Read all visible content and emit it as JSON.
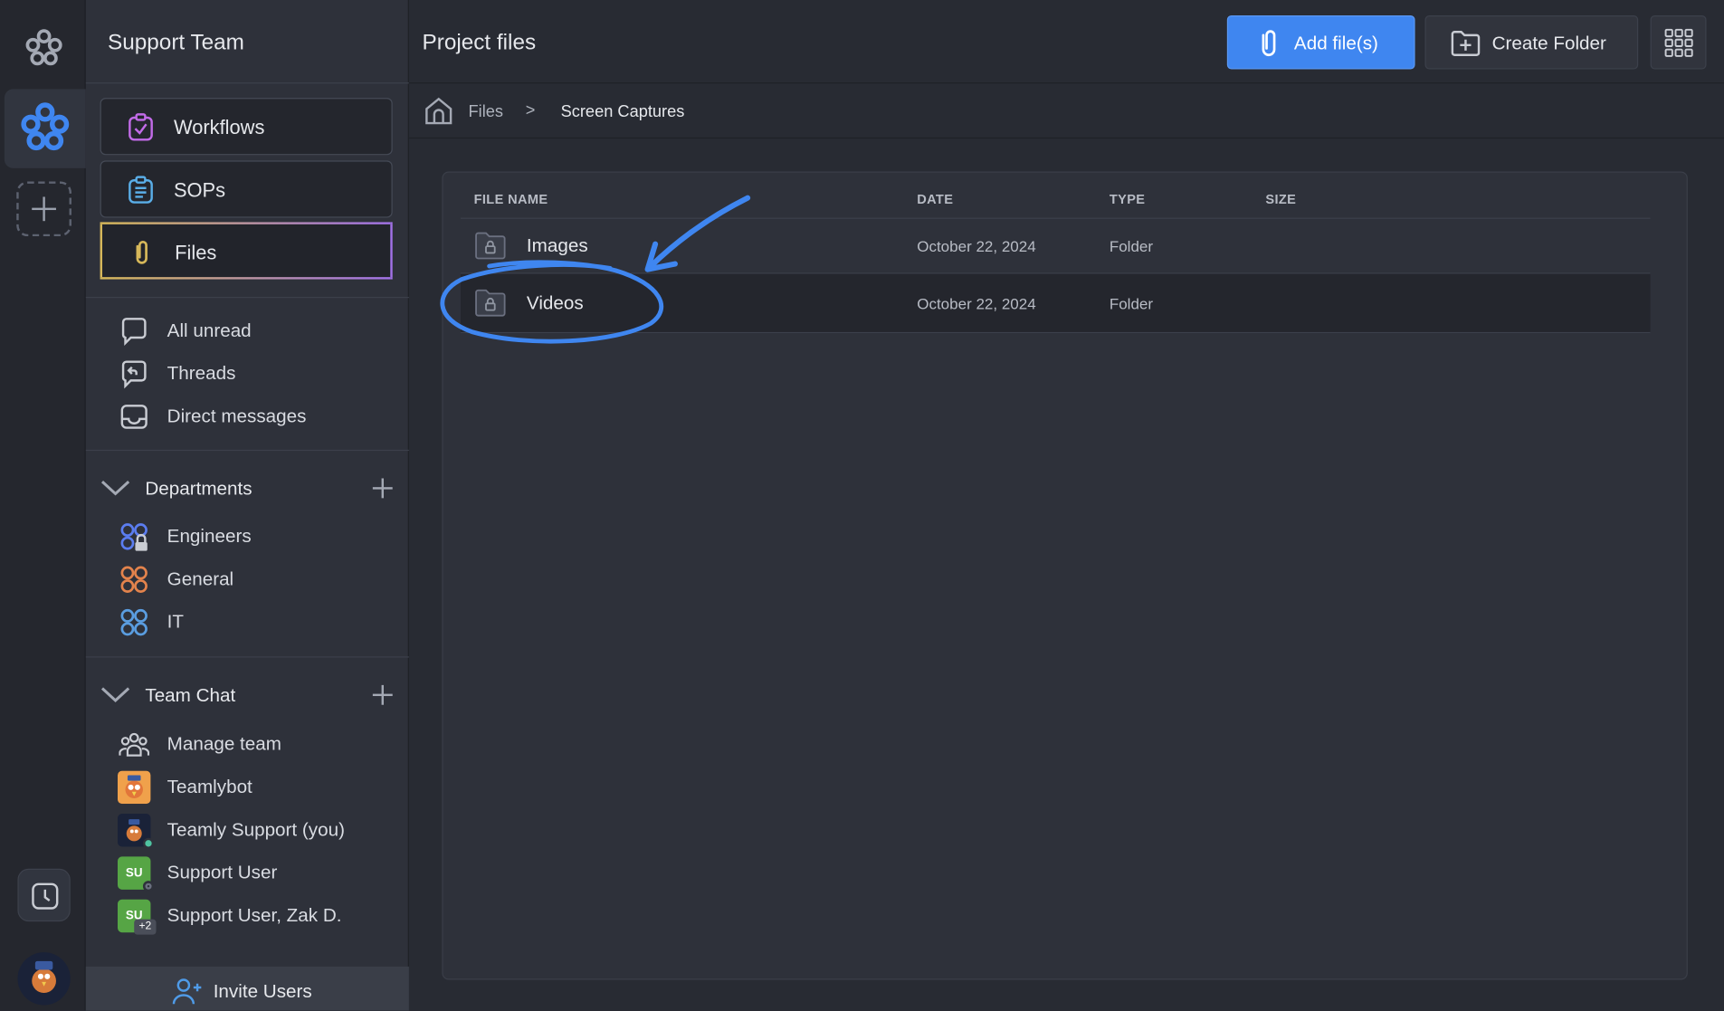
{
  "sidebar": {
    "team_name": "Support Team",
    "nav": [
      {
        "label": "Workflows",
        "icon": "clipboard-check-icon",
        "active": false
      },
      {
        "label": "SOPs",
        "icon": "clipboard-list-icon",
        "active": false
      },
      {
        "label": "Files",
        "icon": "paperclip-icon",
        "active": true
      }
    ],
    "inbox": [
      {
        "label": "All unread",
        "icon": "chat-bubble-icon"
      },
      {
        "label": "Threads",
        "icon": "thread-reply-icon"
      },
      {
        "label": "Direct messages",
        "icon": "inbox-tray-icon"
      }
    ],
    "departments": {
      "label": "Departments",
      "items": [
        {
          "label": "Engineers",
          "icon": "locked-group-icon",
          "color": "#5b7df0"
        },
        {
          "label": "General",
          "icon": "group-icon",
          "color": "#e3834c"
        },
        {
          "label": "IT",
          "icon": "group-icon",
          "color": "#5a9de0"
        }
      ]
    },
    "team_chat": {
      "label": "Team Chat",
      "items": [
        {
          "label": "Manage team",
          "icon": "team-icon"
        },
        {
          "label": "Teamlybot",
          "icon": "bot-avatar"
        },
        {
          "label": "Teamly Support (you)",
          "icon": "user-avatar"
        },
        {
          "label": "Support User",
          "initials": "SU",
          "color": "#56a545"
        },
        {
          "label": "Support User, Zak D.",
          "initials": "SU",
          "badge": "+2",
          "color": "#56a545"
        }
      ]
    },
    "invite_label": "Invite Users"
  },
  "main": {
    "title": "Project files",
    "add_files_label": "Add file(s)",
    "create_folder_label": "Create Folder",
    "breadcrumb": {
      "root": "Files",
      "separator": ">",
      "current": "Screen Captures"
    },
    "columns": [
      "FILE NAME",
      "DATE",
      "TYPE",
      "SIZE"
    ],
    "rows": [
      {
        "name": "Images",
        "date": "October 22, 2024",
        "type": "Folder",
        "size": ""
      },
      {
        "name": "Videos",
        "date": "October 22, 2024",
        "type": "Folder",
        "size": "",
        "selected": true
      }
    ]
  },
  "colors": {
    "accent": "#3f86f0",
    "annotation": "#3f86f0",
    "background": "#282b33",
    "sidebar": "#2e313a"
  }
}
